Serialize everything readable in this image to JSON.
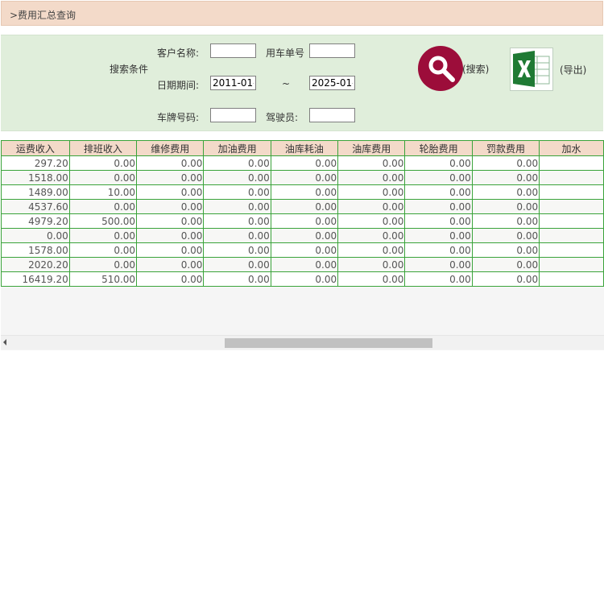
{
  "title": ">费用汇总查询",
  "search": {
    "section_label": "搜索条件",
    "customer_label": "客户名称:",
    "customer_value": "",
    "order_label": "用车单号",
    "order_value": "",
    "date_label": "日期期间:",
    "date_from": "2011-01-",
    "date_sep": "~",
    "date_to": "2025-01-",
    "plate_label": "车牌号码:",
    "plate_value": "",
    "driver_label": "驾驶员:",
    "driver_value": "",
    "search_button_label": "(搜索)",
    "export_button_label": "(导出)",
    "search_icon": "magnifier-icon",
    "export_icon": "excel-icon",
    "search_color": "#9c0d3a",
    "excel_color": "#1f7a34"
  },
  "table": {
    "headers": [
      "运费收入",
      "排班收入",
      "维修费用",
      "加油费用",
      "油库耗油",
      "油库费用",
      "轮胎费用",
      "罚款费用",
      "加水"
    ],
    "rows": [
      [
        "297.20",
        "0.00",
        "0.00",
        "0.00",
        "0.00",
        "0.00",
        "0.00",
        "0.00",
        ""
      ],
      [
        "1518.00",
        "0.00",
        "0.00",
        "0.00",
        "0.00",
        "0.00",
        "0.00",
        "0.00",
        ""
      ],
      [
        "1489.00",
        "10.00",
        "0.00",
        "0.00",
        "0.00",
        "0.00",
        "0.00",
        "0.00",
        ""
      ],
      [
        "4537.60",
        "0.00",
        "0.00",
        "0.00",
        "0.00",
        "0.00",
        "0.00",
        "0.00",
        ""
      ],
      [
        "4979.20",
        "500.00",
        "0.00",
        "0.00",
        "0.00",
        "0.00",
        "0.00",
        "0.00",
        ""
      ],
      [
        "0.00",
        "0.00",
        "0.00",
        "0.00",
        "0.00",
        "0.00",
        "0.00",
        "0.00",
        ""
      ],
      [
        "1578.00",
        "0.00",
        "0.00",
        "0.00",
        "0.00",
        "0.00",
        "0.00",
        "0.00",
        ""
      ],
      [
        "2020.20",
        "0.00",
        "0.00",
        "0.00",
        "0.00",
        "0.00",
        "0.00",
        "0.00",
        ""
      ],
      [
        "16419.20",
        "510.00",
        "0.00",
        "0.00",
        "0.00",
        "0.00",
        "0.00",
        "0.00",
        ""
      ]
    ]
  },
  "colors": {
    "title_bg": "#f3dac9",
    "panel_bg": "#e0eedb",
    "grid_border": "#3aa33a",
    "header_bg": "#f3dac9"
  }
}
